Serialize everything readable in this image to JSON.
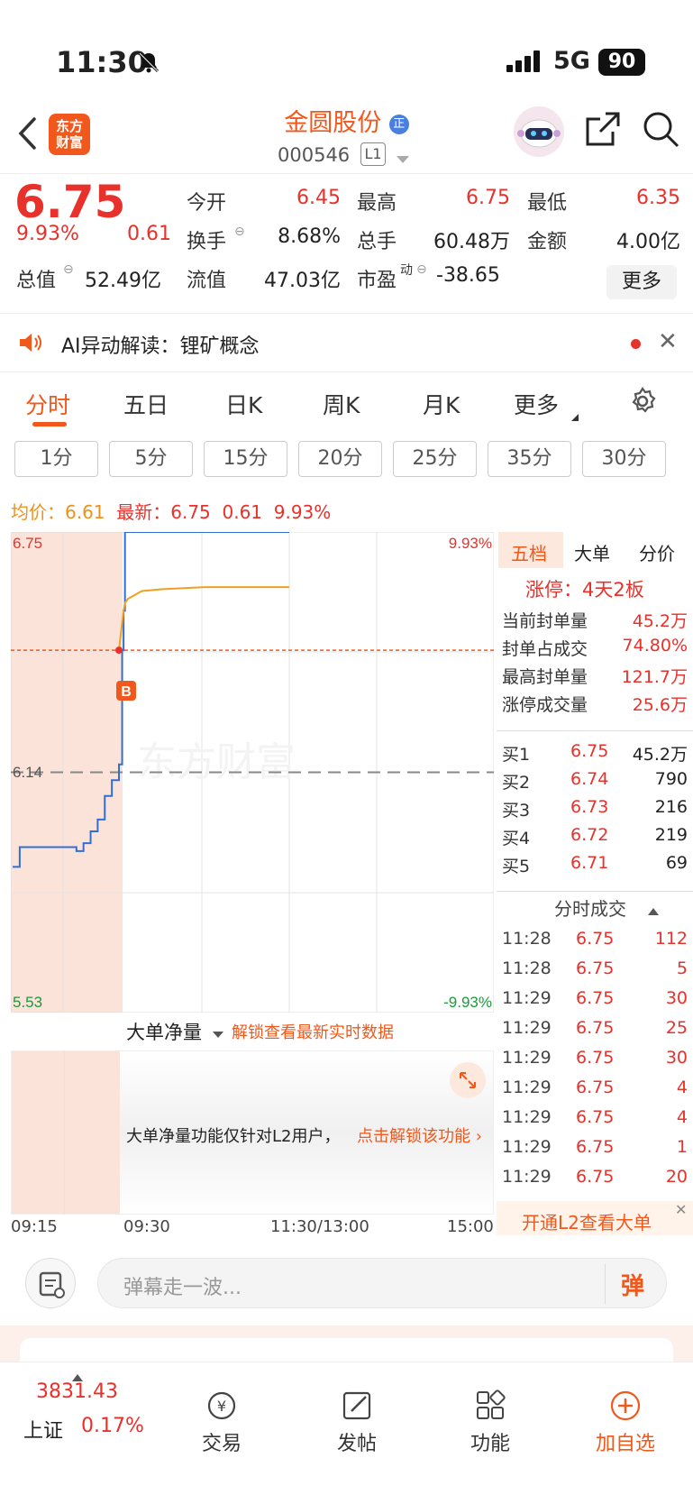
{
  "status": {
    "time": "11:30",
    "network": "5G",
    "battery": "90"
  },
  "header": {
    "logo_line1": "东方",
    "logo_line2": "财富",
    "name": "金圆股份",
    "code": "000546",
    "level": "L1"
  },
  "quote": {
    "price": "6.75",
    "pct": "9.93%",
    "change": "0.61",
    "open_label": "今开",
    "open": "6.45",
    "high_label": "最高",
    "high": "6.75",
    "low_label": "最低",
    "low": "6.35",
    "turnover_label": "换手",
    "turnover": "8.68%",
    "volume_label": "总手",
    "volume": "60.48万",
    "amount_label": "金额",
    "amount": "4.00亿",
    "mktcap_label": "总值",
    "mktcap": "52.49亿",
    "float_label": "流值",
    "float": "47.03亿",
    "pe_label": "市盈",
    "pe_sup": "动",
    "pe": "-38.65",
    "more": "更多"
  },
  "ai_bar": {
    "text": "AI异动解读：锂矿概念"
  },
  "tabs": [
    "分时",
    "五日",
    "日K",
    "周K",
    "月K",
    "更多"
  ],
  "intervals": [
    "1分",
    "5分",
    "15分",
    "20分",
    "25分",
    "35分",
    "30分"
  ],
  "price_line": {
    "avg_label": "均价：",
    "avg": "6.61",
    "last_label": "最新：",
    "last": "6.75",
    "chg": "0.61",
    "pct": "9.93%"
  },
  "chart": {
    "y_top": "6.75",
    "y_mid": "6.14",
    "y_bot": "5.53",
    "pct_top": "9.93%",
    "pct_bot": "-9.93%",
    "marker": "B",
    "watermark": "东方财富",
    "x_labels": [
      "09:15",
      "09:30",
      "11:30/13:00",
      "15:00"
    ]
  },
  "chart_data": {
    "type": "line",
    "ylim": [
      5.53,
      6.75
    ],
    "y_ref": 6.14,
    "x_labels": [
      "09:15",
      "09:30",
      "11:30/13:00",
      "15:00"
    ],
    "series": [
      {
        "name": "最新",
        "color": "#2f6fd6",
        "x": [
          "09:15",
          "09:16",
          "09:20",
          "09:24",
          "09:25",
          "09:26",
          "09:27",
          "09:28",
          "09:29",
          "09:30",
          "09:31",
          "09:32",
          "09:33",
          "09:35",
          "10:00",
          "10:30",
          "11:00",
          "11:30"
        ],
        "y": [
          5.9,
          5.95,
          5.95,
          5.94,
          5.96,
          5.99,
          6.02,
          6.08,
          6.12,
          6.16,
          6.45,
          6.55,
          6.75,
          6.75,
          6.75,
          6.75,
          6.75,
          6.75
        ]
      },
      {
        "name": "均价",
        "color": "#f0a020",
        "x": [
          "09:30",
          "09:31",
          "09:32",
          "09:33",
          "09:35",
          "09:45",
          "10:00",
          "10:30",
          "11:00",
          "11:30"
        ],
        "y": [
          6.45,
          6.52,
          6.55,
          6.57,
          6.58,
          6.6,
          6.605,
          6.61,
          6.61,
          6.61
        ]
      }
    ]
  },
  "volume_panel": {
    "dropdown": "大单净量",
    "unlock": "解锁查看最新实时数据",
    "msg": "大单净量功能仅针对L2用户，",
    "cta": "点击解锁该功能"
  },
  "side_panel": {
    "tabs": [
      "五档",
      "大单",
      "分价"
    ],
    "limit_label": "涨停：4天2板",
    "stats": [
      {
        "label": "当前封单量",
        "value": "45.2万"
      },
      {
        "label": "封单占成交",
        "value": "74.80%"
      },
      {
        "label": "最高封单量",
        "value": "121.7万"
      },
      {
        "label": "涨停成交量",
        "value": "25.6万"
      }
    ],
    "bids": [
      {
        "label": "买1",
        "price": "6.75",
        "vol": "45.2万"
      },
      {
        "label": "买2",
        "price": "6.74",
        "vol": "790"
      },
      {
        "label": "买3",
        "price": "6.73",
        "vol": "216"
      },
      {
        "label": "买4",
        "price": "6.72",
        "vol": "219"
      },
      {
        "label": "买5",
        "price": "6.71",
        "vol": "69"
      }
    ],
    "trades_title": "分时成交",
    "trades": [
      {
        "t": "11:28",
        "p": "6.75",
        "v": "112"
      },
      {
        "t": "11:28",
        "p": "6.75",
        "v": "5"
      },
      {
        "t": "11:29",
        "p": "6.75",
        "v": "30"
      },
      {
        "t": "11:29",
        "p": "6.75",
        "v": "25"
      },
      {
        "t": "11:29",
        "p": "6.75",
        "v": "30"
      },
      {
        "t": "11:29",
        "p": "6.75",
        "v": "4"
      },
      {
        "t": "11:29",
        "p": "6.75",
        "v": "4"
      },
      {
        "t": "11:29",
        "p": "6.75",
        "v": "1"
      },
      {
        "t": "11:29",
        "p": "6.75",
        "v": "20"
      }
    ],
    "l2_cta": "开通L2查看大单"
  },
  "comment": {
    "placeholder": "弹幕走一波...",
    "danmu": "弹"
  },
  "bottom_nav": {
    "index_value": "3831.43",
    "index_name": "上证",
    "index_pct": "0.17%",
    "items": [
      "交易",
      "发帖",
      "功能",
      "加自选"
    ]
  }
}
